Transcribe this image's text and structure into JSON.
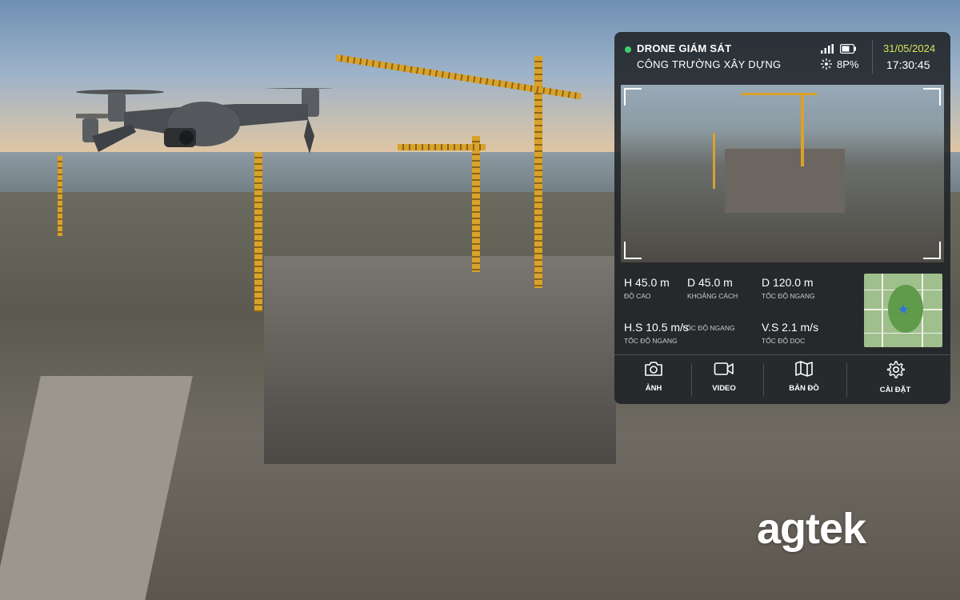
{
  "hud": {
    "status_dot_color": "#3fd06b",
    "title_line1": "DRONE GIÁM SÁT",
    "title_line2": "CÔNG TRƯỜNG XÂY DỰNG",
    "battery_text": "8P%",
    "date": "31/05/2024",
    "time": "17:30:45",
    "icons": [
      "signal-icon",
      "battery-icon",
      "satellite-icon"
    ]
  },
  "stats": {
    "height": {
      "value": "H 45.0 m",
      "label": "ĐỘ CAO"
    },
    "distance": {
      "value": "D 45.0 m",
      "label": "KHOẢNG CÁCH"
    },
    "distance2": {
      "value": "D 120.0 m",
      "label": "TỐC ĐỘ NGANG"
    },
    "h_speed": {
      "value": "H.S 10.5 m/s",
      "label": "TỐC ĐỘ NGANG"
    },
    "h_speed_dup": {
      "value": "",
      "label": "TỐC ĐỘ NGANG"
    },
    "v_speed": {
      "value": "V.S 2.1 m/s",
      "label": "TỐC ĐỘ DỌC"
    }
  },
  "toolbar": {
    "photo_label": "ẢNH",
    "video_label": "VIDEO",
    "map_label": "BẢN ĐỒ",
    "settings_label": "CÀI ĐẶT"
  },
  "brand": {
    "logo_text": "agtek",
    "accent_color": "#d7e35a"
  }
}
